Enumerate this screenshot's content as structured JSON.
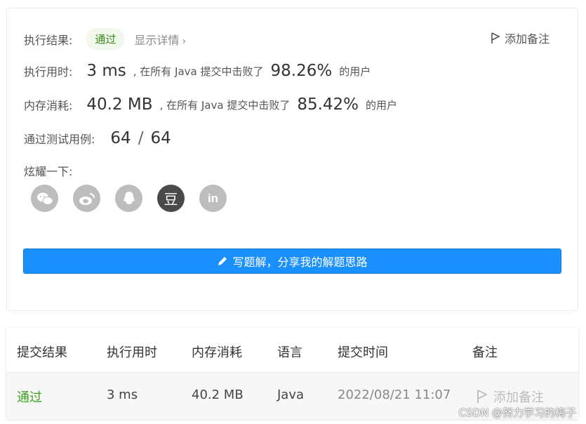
{
  "result": {
    "label": "执行结果:",
    "status": "通过",
    "detail_link": "显示详情",
    "add_note": "添加备注"
  },
  "runtime": {
    "label": "执行用时:",
    "value": "3 ms",
    "beat_text": ", 在所有 Java 提交中击败了",
    "percent": "98.26%",
    "suffix": "的用户"
  },
  "memory": {
    "label": "内存消耗:",
    "value": "40.2 MB",
    "beat_text": ", 在所有 Java 提交中击败了",
    "percent": "85.42%",
    "suffix": "的用户"
  },
  "tests": {
    "label": "通过测试用例:",
    "passed": "64",
    "sep": "/",
    "total": "64"
  },
  "share": {
    "label": "炫耀一下:",
    "icons": [
      "wechat-icon",
      "weibo-icon",
      "qq-icon",
      "douban-icon",
      "linkedin-icon"
    ],
    "douban_glyph": "豆",
    "linkedin_glyph": "in"
  },
  "write_button": "写题解，分享我的解题思路",
  "table": {
    "headers": [
      "提交结果",
      "执行用时",
      "内存消耗",
      "语言",
      "提交时间",
      "备注"
    ],
    "row": {
      "result": "通过",
      "runtime": "3 ms",
      "memory": "40.2 MB",
      "language": "Java",
      "time": "2022/08/21 11:07",
      "note": "添加备注"
    }
  },
  "watermark": "CSDN @努力学习的梅子",
  "colors": {
    "accent": "#1a90ff",
    "pass": "#3ca21e",
    "dark_icon": "#4a4a4a",
    "gray_icon": "#bdbdbd"
  }
}
